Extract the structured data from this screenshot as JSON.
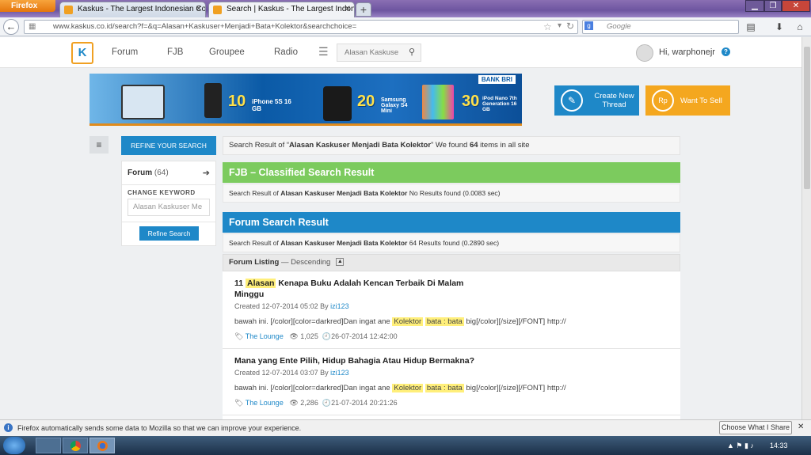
{
  "browser": {
    "app_button": "Firefox",
    "tabs": [
      {
        "label": "Kaskus - The Largest Indonesian Com..."
      },
      {
        "label": "Search | Kaskus - The Largest Indones..."
      }
    ],
    "new_tab": "+",
    "url": "www.kaskus.co.id/search?f=&q=Alasan+Kaskuser+Menjadi+Bata+Kolektor&searchchoice=",
    "search_engine": "Google",
    "search_placeholder": "Google"
  },
  "site": {
    "logo": "K",
    "nav": [
      "Forum",
      "FJB",
      "Groupee",
      "Radio"
    ],
    "search_placeholder": "Alasan Kaskuse",
    "user_greeting": "Hi, warphonejr",
    "help": "?"
  },
  "banner": {
    "bank": "BANK BRI",
    "promo1_num": "10",
    "promo1_text": "iPhone 5S 16 GB",
    "promo2_num": "20",
    "promo2_text": "Samsung Galaxy S4 Mini",
    "promo3_num": "30",
    "promo3_text": "iPod Nano 7th Generation 16 GB"
  },
  "actions": {
    "create_thread": "Create New Thread",
    "want_to_sell": "Want To Sell",
    "sell_icon": "Rp"
  },
  "sidebar": {
    "refine_label": "REFINE YOUR SEARCH",
    "forum_label": "Forum",
    "forum_count": "(64)",
    "change_keyword_label": "CHANGE KEYWORD",
    "keyword_value": "Alasan Kaskuser Me",
    "refine_button": "Refine Search"
  },
  "results": {
    "header_prefix": "Search Result of “",
    "query": "Alasan Kaskuser Menjadi Bata Kolektor",
    "header_mid": "” We found ",
    "count": "64",
    "header_suffix": " items in all site",
    "fjb_title": "FJB – Classified Search Result",
    "fjb_prefix": "Search Result of ",
    "fjb_status": " No Results found (0.0083 sec)",
    "forum_title": "Forum Search Result",
    "forum_prefix": "Search Result of ",
    "forum_status": " 64 Results found (0.2890 sec)",
    "listing_label": "Forum Listing",
    "listing_order": " — Descending"
  },
  "threads": [
    {
      "pre": "11 ",
      "hl": "Alasan",
      "post": " Kenapa Buku Adalah Kencan Terbaik Di Malam Minggu",
      "created": "Created 12-07-2014 05:02 By ",
      "author": "izi123",
      "body_pre": "bawah ini. [/color][color=darkred]Dan ingat ane ",
      "hl1": "Kolektor",
      "hl2": "bata : bata",
      "body_post": " big[/color][/size][/FONT] http://",
      "forum": "The Lounge",
      "views": "1,025",
      "last": "26-07-2014 12:42:00"
    },
    {
      "title": "Mana yang Ente Pilih, Hidup Bahagia Atau Hidup Bermakna?",
      "created": "Created 12-07-2014 03:07 By ",
      "author": "izi123",
      "body_pre": "bawah ini. [/color][color=darkred]Dan ingat ane ",
      "hl1": "Kolektor",
      "hl2": "bata : bata",
      "body_post": " big[/color][/size][/FONT] http://",
      "forum": "The Lounge",
      "views": "2,286",
      "last": "21-07-2014 20:21:26"
    }
  ],
  "notification": {
    "text": "Firefox automatically sends some data to Mozilla so that we can improve your experience.",
    "button": "Choose What I Share"
  },
  "taskbar": {
    "clock": "14:33"
  }
}
